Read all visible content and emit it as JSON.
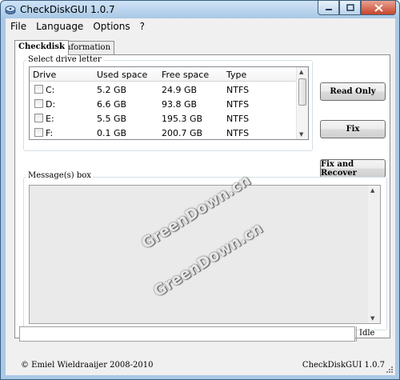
{
  "window": {
    "title": "CheckDiskGUI 1.0.7"
  },
  "menu": [
    "File",
    "Language",
    "Options",
    "?"
  ],
  "tabs": [
    {
      "label": "Checkdisk",
      "active": true
    },
    {
      "label": "Information",
      "active": false
    }
  ],
  "drive_group": {
    "label": "Select drive letter",
    "columns": [
      "Drive",
      "Used space",
      "Free space",
      "Type"
    ],
    "rows": [
      {
        "drive": "C:",
        "used": "5.2 GB",
        "free": "24.9 GB",
        "type": "NTFS",
        "checked": false
      },
      {
        "drive": "D:",
        "used": "6.6 GB",
        "free": "93.8 GB",
        "type": "NTFS",
        "checked": false
      },
      {
        "drive": "E:",
        "used": "5.5 GB",
        "free": "195.3 GB",
        "type": "NTFS",
        "checked": false
      },
      {
        "drive": "F:",
        "used": "0.1 GB",
        "free": "200.7 GB",
        "type": "NTFS",
        "checked": false
      }
    ]
  },
  "buttons": {
    "read_only": "Read Only",
    "fix": "Fix",
    "fix_recover": "Fix and Recover"
  },
  "message_box": {
    "label": "Message(s) box"
  },
  "status": {
    "text": "Idle"
  },
  "footer": {
    "left": "© Emiel Wieldraaijer 2008-2010",
    "right": "CheckDiskGUI 1.0.7"
  },
  "watermark": {
    "text": "GreenDown.cn"
  },
  "colors": {
    "title_bar": "#a8c8e6",
    "close_button": "#c7452c",
    "panel": "#ffffff",
    "client": "#f0f0f0"
  }
}
